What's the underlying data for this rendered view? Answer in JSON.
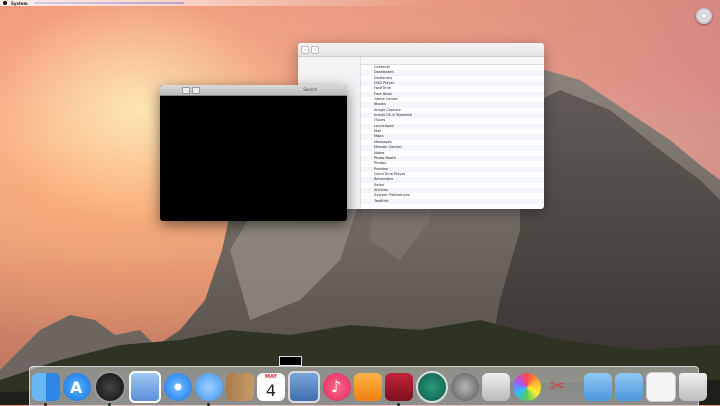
{
  "menubar": {
    "app_name": "System"
  },
  "black_window": {
    "title": "Search"
  },
  "finder": {
    "items": [
      "Contacts",
      "Dashboard",
      "Dictionary",
      "DVD Player",
      "FaceTime",
      "Font Book",
      "Game Center",
      "iBooks",
      "Image Capture",
      "Install OS X Yosemite",
      "iTunes",
      "Launchpad",
      "Mail",
      "Maps",
      "Messages",
      "Mission Control",
      "Notes",
      "Photo Booth",
      "Photos",
      "Preview",
      "QuickTime Player",
      "Reminders",
      "Safari",
      "Stickies",
      "System Preferences",
      "TextEdit"
    ]
  },
  "dock": {
    "calendar_month": "MAY",
    "calendar_day": "4",
    "apps": [
      "finder-icon",
      "app-store-icon",
      "dashboard-icon",
      "preview-icon",
      "safari-icon",
      "messages-icon",
      "contacts-icon",
      "calendar-icon",
      "photo-icon",
      "itunes-icon",
      "ibooks-icon",
      "photo-booth-icon",
      "time-machine-icon",
      "system-preferences-icon",
      "preview-photos-icon",
      "photos-icon",
      "utilities-icon"
    ]
  },
  "colors": {
    "accent": "#2f7ff0"
  }
}
